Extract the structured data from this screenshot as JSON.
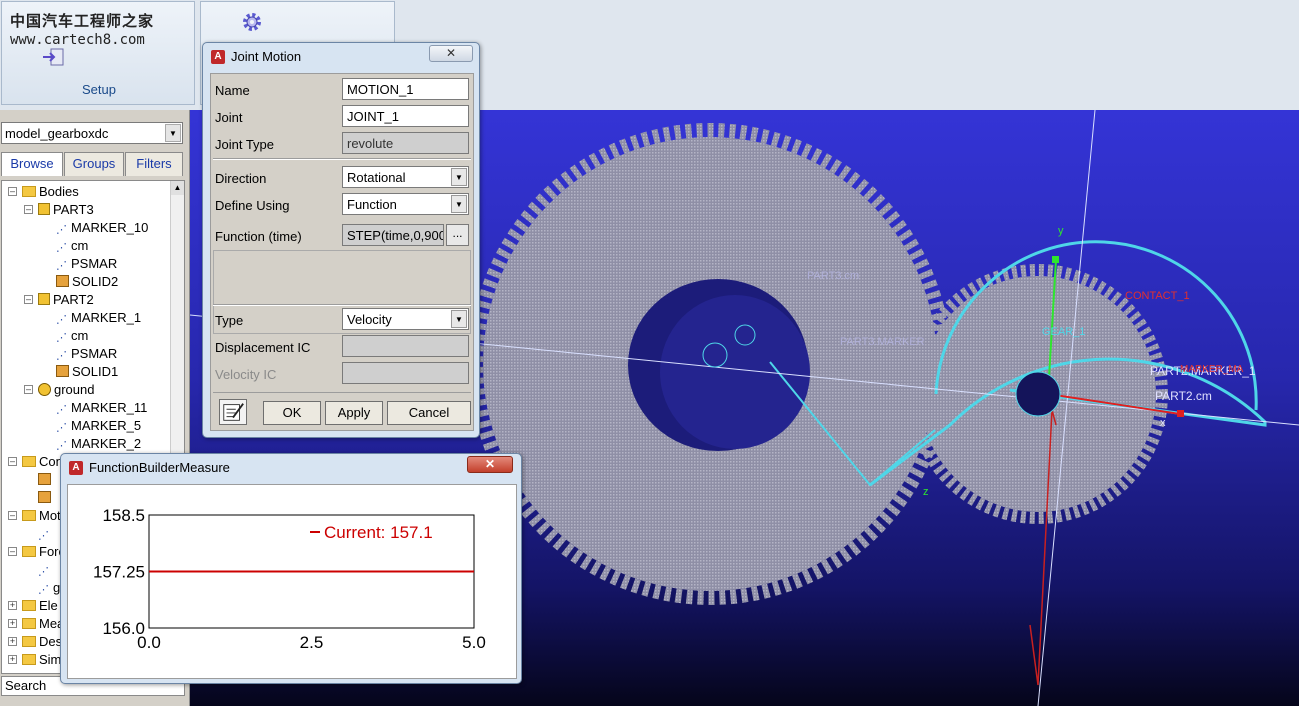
{
  "watermark": {
    "cn": "中国汽车工程师之家",
    "url": "www.cartech8.com"
  },
  "ribbon": {
    "setup_label": "Setup",
    "setup_icon": "import-arrow-icon",
    "settings_icon": "gear-icon"
  },
  "browser": {
    "model": "model_gearboxdc",
    "tabs": [
      "Browse",
      "Groups",
      "Filters"
    ],
    "tree": [
      {
        "label": "Bodies",
        "level": 0,
        "icon": "folder",
        "toggle": "-"
      },
      {
        "label": "PART3",
        "level": 1,
        "icon": "part",
        "toggle": "-"
      },
      {
        "label": "MARKER_10",
        "level": 2,
        "icon": "marker"
      },
      {
        "label": "cm",
        "level": 2,
        "icon": "marker"
      },
      {
        "label": "PSMAR",
        "level": 2,
        "icon": "marker"
      },
      {
        "label": "SOLID2",
        "level": 2,
        "icon": "solid"
      },
      {
        "label": "PART2",
        "level": 1,
        "icon": "part",
        "toggle": "-"
      },
      {
        "label": "MARKER_1",
        "level": 2,
        "icon": "marker"
      },
      {
        "label": "cm",
        "level": 2,
        "icon": "marker"
      },
      {
        "label": "PSMAR",
        "level": 2,
        "icon": "marker"
      },
      {
        "label": "SOLID1",
        "level": 2,
        "icon": "solid"
      },
      {
        "label": "ground",
        "level": 1,
        "icon": "ground",
        "toggle": "-"
      },
      {
        "label": "MARKER_11",
        "level": 2,
        "icon": "marker"
      },
      {
        "label": "MARKER_5",
        "level": 2,
        "icon": "marker"
      },
      {
        "label": "MARKER_2",
        "level": 2,
        "icon": "marker"
      },
      {
        "label": "Con",
        "level": 0,
        "icon": "folder",
        "toggle": "-"
      },
      {
        "label": "",
        "level": 1,
        "icon": "solid"
      },
      {
        "label": "",
        "level": 1,
        "icon": "solid"
      },
      {
        "label": "Mot",
        "level": 0,
        "icon": "folder",
        "toggle": "-"
      },
      {
        "label": "",
        "level": 1,
        "icon": "marker"
      },
      {
        "label": "Forc",
        "level": 0,
        "icon": "folder",
        "toggle": "-"
      },
      {
        "label": "",
        "level": 1,
        "icon": "marker"
      },
      {
        "label": "g",
        "level": 1,
        "icon": "marker"
      },
      {
        "label": "Ele",
        "level": 0,
        "icon": "folder",
        "toggle": "+"
      },
      {
        "label": "Mea",
        "level": 0,
        "icon": "folder",
        "toggle": "+"
      },
      {
        "label": "Des",
        "level": 0,
        "icon": "folder",
        "toggle": "+"
      },
      {
        "label": "Sim",
        "level": 0,
        "icon": "folder",
        "toggle": "+"
      }
    ],
    "search_label": "Search"
  },
  "viewport_labels": {
    "part_cm": "PART3.cm",
    "part3_marker": "PART3.MARKER",
    "contact": "CONTACT_1",
    "gear": "GEAR_1",
    "part2_marker": "PART2.MARKER_1",
    "part2_cm": "PART2.cm",
    "marker_ma": "MARKER_MA",
    "axis_y": "y",
    "axis_z": "z",
    "axis_x": "x"
  },
  "joint_motion": {
    "title": "Joint Motion",
    "app_icon": "adams-icon",
    "fields": {
      "name": {
        "label": "Name",
        "value": "MOTION_1"
      },
      "joint": {
        "label": "Joint",
        "value": "JOINT_1"
      },
      "joint_type": {
        "label": "Joint Type",
        "value": "revolute"
      },
      "direction": {
        "label": "Direction",
        "value": "Rotational"
      },
      "define_using": {
        "label": "Define Using",
        "value": "Function"
      },
      "function_time": {
        "label": "Function (time)",
        "value": "STEP(time,0,900"
      },
      "type": {
        "label": "Type",
        "value": "Velocity"
      },
      "displacement_ic": {
        "label": "Displacement IC",
        "value": ""
      },
      "velocity_ic": {
        "label": "Velocity IC",
        "value": ""
      }
    },
    "more_button": "...",
    "buttons": {
      "ok": "OK",
      "apply": "Apply",
      "cancel": "Cancel"
    }
  },
  "fbm": {
    "title": "FunctionBuilderMeasure",
    "chart_data": {
      "type": "line",
      "x": [
        0.0,
        5.0
      ],
      "series": [
        {
          "name": "Current:  157.1",
          "values": [
            157.25,
            157.25
          ],
          "color": "#cc0000"
        }
      ],
      "xlim": [
        0.0,
        5.0
      ],
      "ylim": [
        156.0,
        158.5
      ],
      "xticks": [
        "0.0",
        "2.5",
        "5.0"
      ],
      "yticks": [
        "158.5",
        "157.25",
        "156.0"
      ],
      "legend": "top-right"
    }
  }
}
